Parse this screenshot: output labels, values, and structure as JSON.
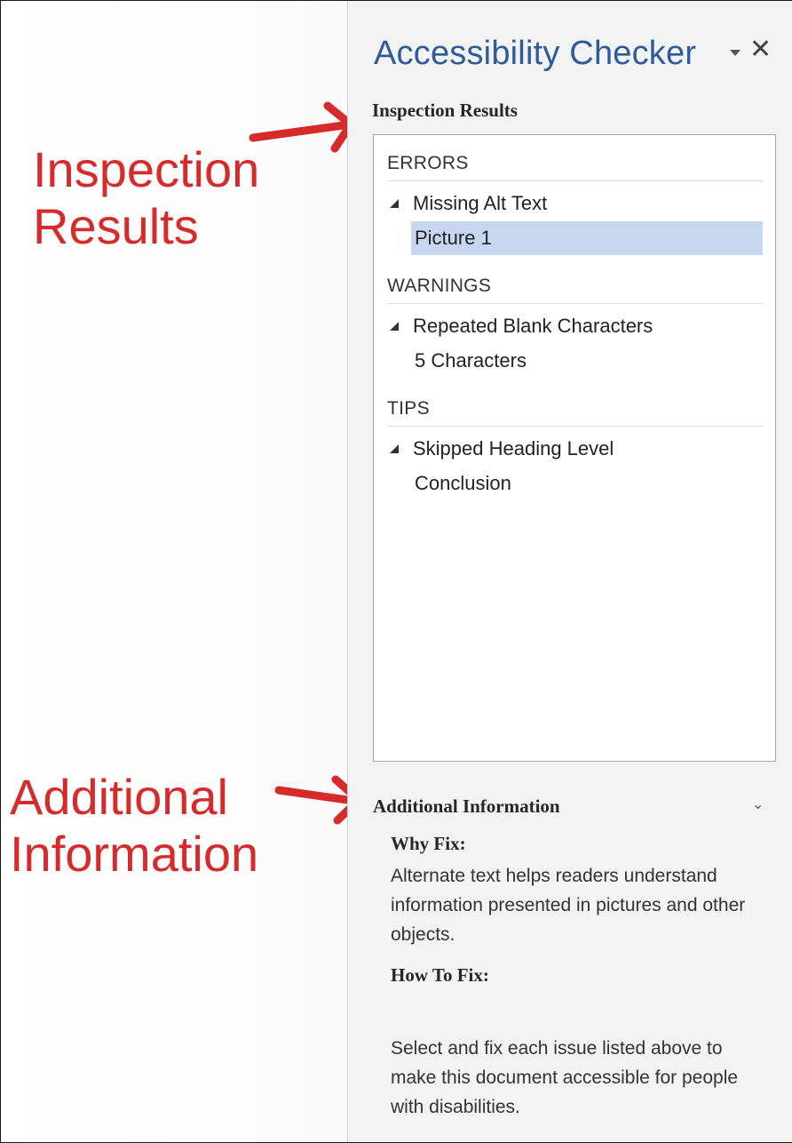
{
  "pane": {
    "title": "Accessibility Checker",
    "close_glyph": "✕",
    "inspection_heading": "Inspection Results",
    "groups": [
      {
        "label": "ERRORS",
        "issue": "Missing Alt Text",
        "items": [
          "Picture 1"
        ],
        "selected_item": "Picture 1"
      },
      {
        "label": "WARNINGS",
        "issue": "Repeated Blank Characters",
        "items": [
          "5 Characters"
        ]
      },
      {
        "label": "TIPS",
        "issue": "Skipped Heading Level",
        "items": [
          "Conclusion"
        ]
      }
    ],
    "additional_info": {
      "heading": "Additional Information",
      "why_fix_label": "Why Fix:",
      "why_fix_text": "Alternate text helps readers understand information presented in pictures and other objects.",
      "how_to_fix_label": "How To Fix:",
      "how_to_fix_text": "Select and fix each issue listed above to make this document accessible for people with disabilities."
    }
  },
  "annotations": {
    "inspection_callout": [
      "Inspection",
      "Results"
    ],
    "additional_callout": [
      "Additional",
      "Information"
    ],
    "color": "#d62b2b"
  },
  "colors": {
    "pane_background": "#f3f3f3",
    "title_blue": "#2f5b9a",
    "selection": "#c6d7ef"
  },
  "icons": [
    "pane-menu-icon",
    "close-icon",
    "expand-triangle-icon",
    "chevron-down-icon",
    "red-arrow-icon"
  ]
}
